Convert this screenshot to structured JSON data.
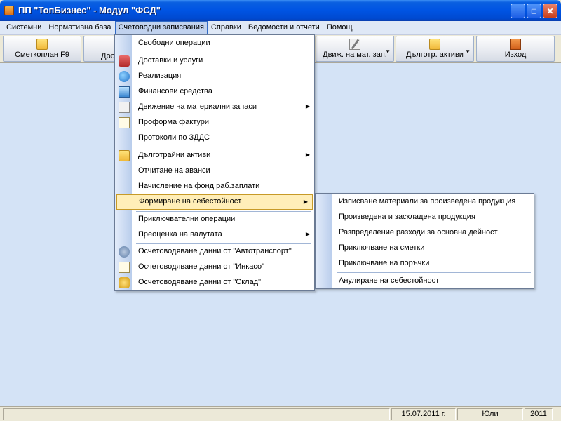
{
  "window": {
    "title": "ПП \"ТопБизнес\" - Модул \"ФСД\"",
    "minimize": "_",
    "maximize": "□",
    "close": "✕"
  },
  "menubar": {
    "items": [
      "Системни",
      "Нормативна база",
      "Счетоводни записвания",
      "Справки",
      "Ведомости и отчети",
      "Помощ"
    ]
  },
  "toolbar": {
    "buttons": [
      {
        "label": "Сметкоплан F9",
        "icon": "folder-icon"
      },
      {
        "label": "Дос",
        "icon": ""
      },
      {
        "label": "Движ. на мат. зап.",
        "icon": "pencil-icon"
      },
      {
        "label": "Дълготр. активи",
        "icon": "folder-icon"
      },
      {
        "label": "Изход",
        "icon": "exit-icon"
      }
    ]
  },
  "menu": {
    "items": [
      {
        "label": "Свободни операции",
        "icon": ""
      },
      {
        "label": "Доставки и услуги",
        "icon": "truck-icon"
      },
      {
        "label": "Реализация",
        "icon": "globe-icon"
      },
      {
        "label": "Финансови средства",
        "icon": "calculator-icon"
      },
      {
        "label": "Движение на материални запаси",
        "icon": "pencil-icon",
        "submenu": true
      },
      {
        "label": "Проформа фактури",
        "icon": "document-icon"
      },
      {
        "label": "Протоколи по ЗДДС",
        "icon": ""
      },
      {
        "label": "Дълготрайни активи",
        "icon": "folder-icon",
        "submenu": true
      },
      {
        "label": "Отчитане на аванси",
        "icon": ""
      },
      {
        "label": "Начисление на фонд раб.заплати",
        "icon": ""
      },
      {
        "label": "Формиране на себестойност",
        "icon": "",
        "submenu": true
      },
      {
        "label": "Приключвателни операции",
        "icon": ""
      },
      {
        "label": "Преоценка на валутата",
        "icon": "",
        "submenu": true
      },
      {
        "label": "Осчетоводяване данни от \"Автотранспорт\"",
        "icon": "arrows-icon"
      },
      {
        "label": "Осчетоводяване данни от \"Инкасо\"",
        "icon": "document-icon"
      },
      {
        "label": "Осчетоводяване данни от \"Склад\"",
        "icon": "coins-icon"
      }
    ]
  },
  "submenu": {
    "items": [
      "Изписване материали за произведена продукция",
      "Произведена и заскладена продукция",
      "Разпределение разходи за основна дейност",
      "Приключване на сметки",
      "Приключване на поръчки",
      "Анулиране на себестойност"
    ]
  },
  "status": {
    "date": "15.07.2011 г.",
    "month": "Юли",
    "year": "2011"
  },
  "colors": {
    "titlebar": "#0054e3",
    "client": "#d4e3f6",
    "highlight": "#ffeeb8"
  }
}
